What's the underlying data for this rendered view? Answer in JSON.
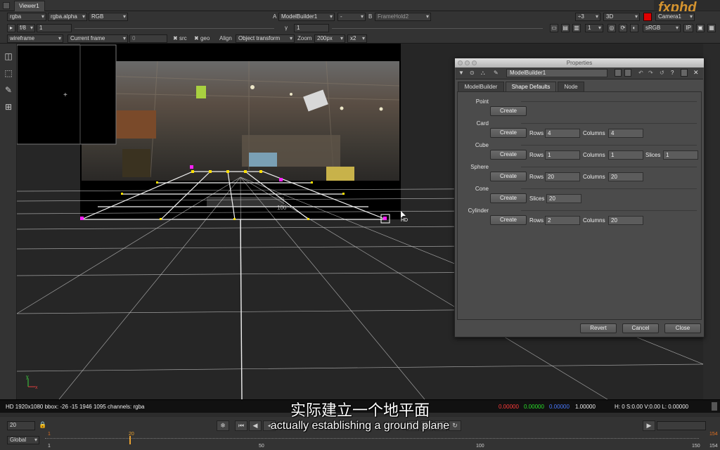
{
  "tabbar": {
    "tab": "Viewer1"
  },
  "tb1": {
    "channels": "rgba",
    "alpha": "rgba.alpha",
    "colorspace": "RGB",
    "a_label": "A",
    "a_input": "ModelBuilder1",
    "a_op": "-",
    "b_label": "B",
    "b_input": "FrameHold2",
    "downrez": "÷3",
    "view": "3D",
    "camera": "Camera1"
  },
  "tb2": {
    "fstop": "f/8",
    "gain": "1",
    "gamma_label": "γ",
    "gamma": "1",
    "proxy": "1",
    "lut": "sRGB",
    "ip": "IP"
  },
  "tb3": {
    "render_mode": "wireframe",
    "frame_mode": "Current frame",
    "frame_value": "0",
    "src": "src",
    "geo": "geo",
    "align_label": "Align",
    "align_value": "Object transform",
    "zoom_label": "Zoom",
    "zoom_value": "200px",
    "scale": "x2"
  },
  "viewport": {
    "scale_label": "100",
    "format_label": "HD",
    "axis_y": "y",
    "axis_x": "x"
  },
  "properties": {
    "title": "Properties",
    "node_name": "ModelBuilder1",
    "tabs": [
      "ModelBuilder",
      "Shape Defaults",
      "Node"
    ],
    "create_label": "Create",
    "sections": [
      {
        "name": "Point",
        "fields": []
      },
      {
        "name": "Card",
        "fields": [
          {
            "label": "Rows",
            "value": "4"
          },
          {
            "label": "Columns",
            "value": "4"
          }
        ]
      },
      {
        "name": "Cube",
        "fields": [
          {
            "label": "Rows",
            "value": "1"
          },
          {
            "label": "Columns",
            "value": "1"
          },
          {
            "label": "Slices",
            "value": "1"
          }
        ]
      },
      {
        "name": "Sphere",
        "fields": [
          {
            "label": "Rows",
            "value": "20"
          },
          {
            "label": "Columns",
            "value": "20"
          }
        ]
      },
      {
        "name": "Cone",
        "fields": [
          {
            "label": "Slices",
            "value": "20"
          }
        ]
      },
      {
        "name": "Cylinder",
        "fields": [
          {
            "label": "Rows",
            "value": "2"
          },
          {
            "label": "Columns",
            "value": "20"
          }
        ]
      }
    ],
    "revert": "Revert",
    "cancel": "Cancel",
    "close": "Close"
  },
  "status": {
    "info": "HD 1920x1080 bbox: -26 -15 1946 1095 channels: rgba",
    "r": "0.00000",
    "g": "0.00000",
    "b": "0.00000",
    "a": "1.00000",
    "hsv": "H: 0 S:0.00 V:0.00  L: 0.00000"
  },
  "subtitles": {
    "zh": "实际建立一个地平面",
    "en": "actually establishing a ground plane"
  },
  "timeline": {
    "frame": "20",
    "scope": "Global",
    "ticks": [
      "1",
      "50",
      "100",
      "150"
    ],
    "start": "1",
    "end": "154",
    "in_mark": "1",
    "current_mark": "20",
    "out_mark": "154"
  },
  "logo": "fxphd",
  "colors": {
    "accent": "#e8a030",
    "red": "#e00000",
    "green": "#00d000",
    "blue": "#3060ff"
  }
}
